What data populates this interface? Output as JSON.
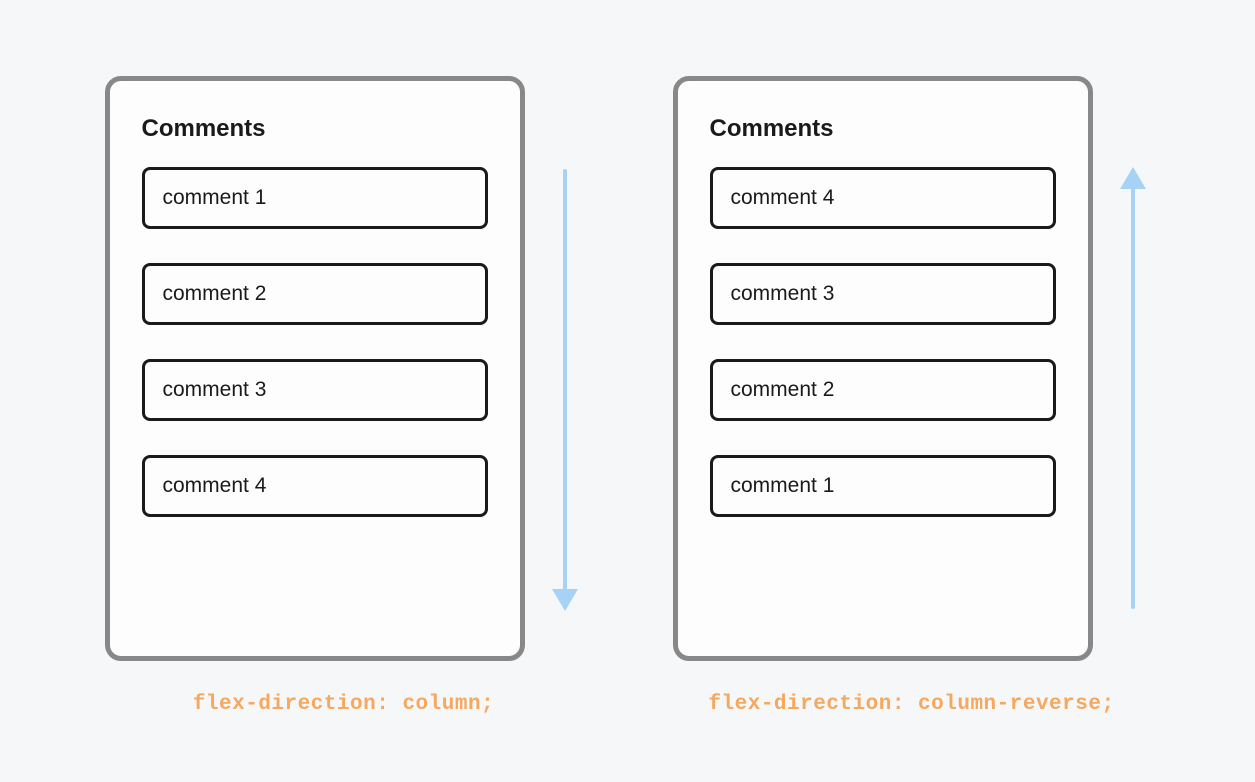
{
  "colors": {
    "background": "#f6f7f9",
    "panel_border": "#888888",
    "panel_fill": "#fdfdfd",
    "text": "#1a1a1a",
    "arrow": "#a6d3f5",
    "caption": "#f5a85e"
  },
  "left": {
    "title": "Comments",
    "items": [
      {
        "label": "comment 1"
      },
      {
        "label": "comment 2"
      },
      {
        "label": "comment 3"
      },
      {
        "label": "comment 4"
      }
    ],
    "arrow_direction": "down",
    "caption": "flex-direction: column;"
  },
  "right": {
    "title": "Comments",
    "items": [
      {
        "label": "comment 4"
      },
      {
        "label": "comment 3"
      },
      {
        "label": "comment 2"
      },
      {
        "label": "comment 1"
      }
    ],
    "arrow_direction": "up",
    "caption": "flex-direction: column-reverse;"
  }
}
